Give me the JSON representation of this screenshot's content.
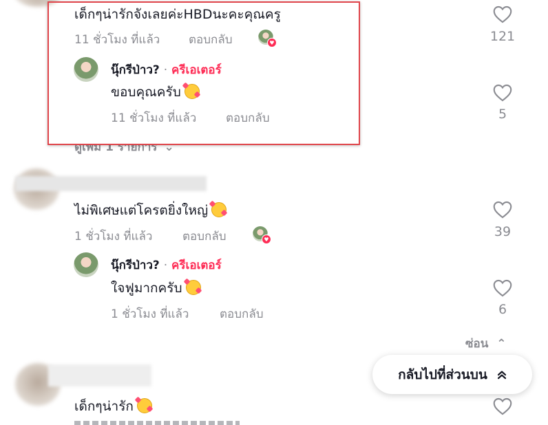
{
  "comments": [
    {
      "text": "เด็กๆน่ารักจังเลยค่ะHBDนะคะคุณครู",
      "time": "11 ชั่วโมง ที่แล้ว",
      "reply_label": "ตอบกลับ",
      "likes": "121",
      "reply": {
        "author": "นุ๊กรีป่าว?",
        "separator": "·",
        "tag": "ครีเอเตอร์",
        "text": "ขอบคุณครับ",
        "time": "11 ชั่วโมง ที่แล้ว",
        "reply_label": "ตอบกลับ",
        "likes": "5"
      },
      "view_more": "ดูเพิ่ม 1 รายการ"
    },
    {
      "text": "ไม่พิเศษแต่โครตยิ่งใหญ่",
      "time": "1 ชั่วโมง ที่แล้ว",
      "reply_label": "ตอบกลับ",
      "likes": "39",
      "reply": {
        "author": "นุ๊กรีป่าว?",
        "separator": "·",
        "tag": "ครีเอเตอร์",
        "text": "ใจฟูมากครับ",
        "time": "1 ชั่วโมง ที่แล้ว",
        "reply_label": "ตอบกลับ",
        "likes": "6"
      },
      "hide_label": "ซ่อน"
    },
    {
      "text": "เด็กๆน่ารัก"
    }
  ],
  "back_to_top": "กลับไปที่ส่วนบน",
  "colors": {
    "creator_tag": "#fe2c55",
    "highlight": "#e0444a",
    "meta": "#8a8b91"
  },
  "icons": [
    "heart-outline-icon",
    "creator-liked-icon",
    "smiling-hearts-emoji",
    "chevron-down-icon",
    "chevron-up-icon",
    "double-chevron-up-icon"
  ]
}
